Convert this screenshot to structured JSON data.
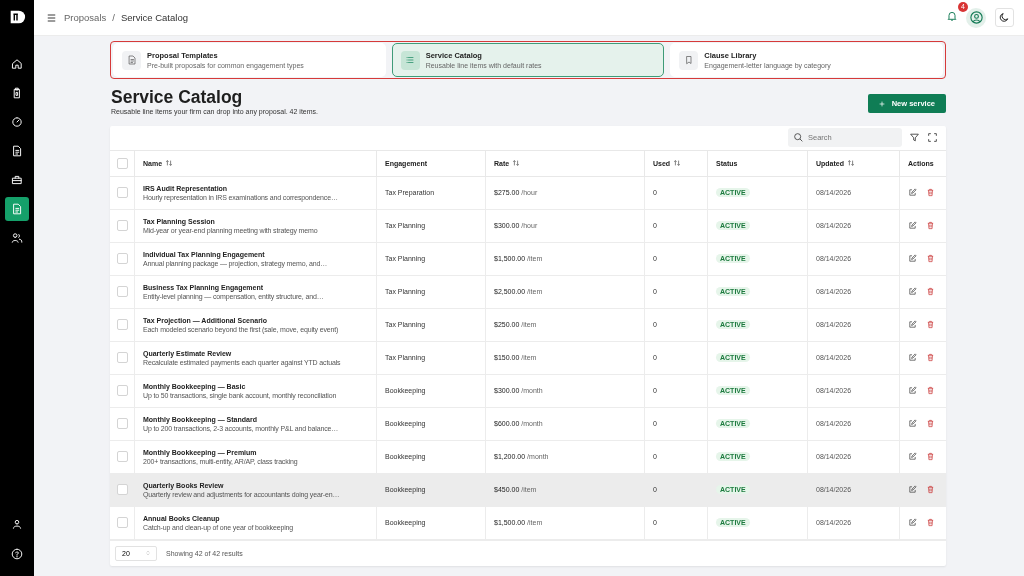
{
  "breadcrumb": [
    "Proposals",
    "Service Catalog"
  ],
  "breadcrumb_separator": "/",
  "topbar": {
    "notification_count": "4"
  },
  "sidebar": {
    "items": [
      {
        "selected": false
      },
      {
        "selected": false
      },
      {
        "selected": false
      },
      {
        "selected": false
      },
      {
        "selected": false
      },
      {
        "selected": true
      },
      {
        "selected": false
      }
    ]
  },
  "tabs": [
    {
      "title": "Proposal Templates",
      "subtitle": "Pre-built proposals for common engagement types",
      "selected": false
    },
    {
      "title": "Service Catalog",
      "subtitle": "Reusable line items with default rates",
      "selected": true
    },
    {
      "title": "Clause Library",
      "subtitle": "Engagement-letter language by category",
      "selected": false
    }
  ],
  "page": {
    "title": "Service Catalog",
    "subtitle": "Reusable line items your firm can drop into any proposal. 42 items.",
    "primary_button": "New service"
  },
  "toolbar": {
    "search_placeholder": "Search"
  },
  "table": {
    "select_all_checked": false,
    "columns": [
      {
        "label": "Name",
        "sortable": true
      },
      {
        "label": "Engagement",
        "sortable": false
      },
      {
        "label": "Rate",
        "sortable": true
      },
      {
        "label": "Used",
        "sortable": true
      },
      {
        "label": "Status",
        "sortable": false
      },
      {
        "label": "Updated",
        "sortable": true
      },
      {
        "label": "Actions",
        "sortable": false
      }
    ],
    "rows": [
      {
        "name": "IRS Audit Representation",
        "description": "Hourly representation in IRS examinations and correspondence…",
        "engagement": "Tax Preparation",
        "rate": "$275.00",
        "unit": "/hour",
        "used": "0",
        "status": "ACTIVE",
        "updated": "08/14/2026",
        "checked": false,
        "highlighted": false
      },
      {
        "name": "Tax Planning Session",
        "description": "Mid-year or year-end planning meeting with strategy memo",
        "engagement": "Tax Planning",
        "rate": "$300.00",
        "unit": "/hour",
        "used": "0",
        "status": "ACTIVE",
        "updated": "08/14/2026",
        "checked": false,
        "highlighted": false
      },
      {
        "name": "Individual Tax Planning Engagement",
        "description": "Annual planning package — projection, strategy memo, and…",
        "engagement": "Tax Planning",
        "rate": "$1,500.00",
        "unit": "/item",
        "used": "0",
        "status": "ACTIVE",
        "updated": "08/14/2026",
        "checked": false,
        "highlighted": false
      },
      {
        "name": "Business Tax Planning Engagement",
        "description": "Entity-level planning — compensation, entity structure, and…",
        "engagement": "Tax Planning",
        "rate": "$2,500.00",
        "unit": "/item",
        "used": "0",
        "status": "ACTIVE",
        "updated": "08/14/2026",
        "checked": false,
        "highlighted": false
      },
      {
        "name": "Tax Projection — Additional Scenario",
        "description": "Each modeled scenario beyond the first (sale, move, equity event)",
        "engagement": "Tax Planning",
        "rate": "$250.00",
        "unit": "/item",
        "used": "0",
        "status": "ACTIVE",
        "updated": "08/14/2026",
        "checked": false,
        "highlighted": false
      },
      {
        "name": "Quarterly Estimate Review",
        "description": "Recalculate estimated payments each quarter against YTD actuals",
        "engagement": "Tax Planning",
        "rate": "$150.00",
        "unit": "/item",
        "used": "0",
        "status": "ACTIVE",
        "updated": "08/14/2026",
        "checked": false,
        "highlighted": false
      },
      {
        "name": "Monthly Bookkeeping — Basic",
        "description": "Up to 50 transactions, single bank account, monthly reconciliation",
        "engagement": "Bookkeeping",
        "rate": "$300.00",
        "unit": "/month",
        "used": "0",
        "status": "ACTIVE",
        "updated": "08/14/2026",
        "checked": false,
        "highlighted": false
      },
      {
        "name": "Monthly Bookkeeping — Standard",
        "description": "Up to 200 transactions, 2-3 accounts, monthly P&L and balance…",
        "engagement": "Bookkeeping",
        "rate": "$600.00",
        "unit": "/month",
        "used": "0",
        "status": "ACTIVE",
        "updated": "08/14/2026",
        "checked": false,
        "highlighted": false
      },
      {
        "name": "Monthly Bookkeeping — Premium",
        "description": "200+ transactions, multi-entity, AR/AP, class tracking",
        "engagement": "Bookkeeping",
        "rate": "$1,200.00",
        "unit": "/month",
        "used": "0",
        "status": "ACTIVE",
        "updated": "08/14/2026",
        "checked": false,
        "highlighted": false
      },
      {
        "name": "Quarterly Books Review",
        "description": "Quarterly review and adjustments for accountants doing year-en…",
        "engagement": "Bookkeeping",
        "rate": "$450.00",
        "unit": "/item",
        "used": "0",
        "status": "ACTIVE",
        "updated": "08/14/2026",
        "checked": false,
        "highlighted": true
      },
      {
        "name": "Annual Books Cleanup",
        "description": "Catch-up and clean-up of one year of bookkeeping",
        "engagement": "Bookkeeping",
        "rate": "$1,500.00",
        "unit": "/item",
        "used": "0",
        "status": "ACTIVE",
        "updated": "08/14/2026",
        "checked": false,
        "highlighted": false
      }
    ]
  },
  "footer": {
    "page_size": "20",
    "summary": "Showing 42 of 42 results"
  }
}
